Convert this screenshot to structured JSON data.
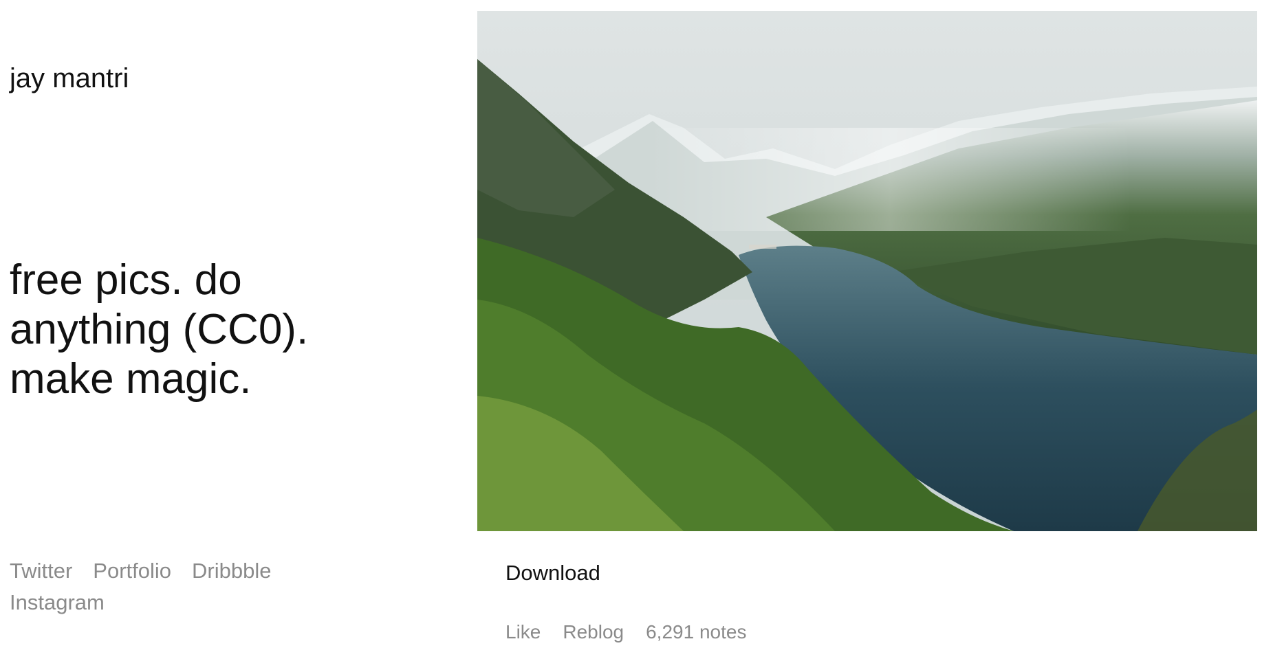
{
  "blog": {
    "title": "jay mantri",
    "tagline": "free pics. do anything (CC0). make magic."
  },
  "links": [
    {
      "label": "Twitter"
    },
    {
      "label": "Portfolio"
    },
    {
      "label": "Dribbble"
    },
    {
      "label": "Instagram"
    }
  ],
  "post": {
    "download_label": "Download",
    "like_label": "Like",
    "reblog_label": "Reblog",
    "notes_label": "6,291 notes"
  },
  "colors": {
    "text": "#111111",
    "muted": "#8a8a8a",
    "background": "#ffffff"
  }
}
